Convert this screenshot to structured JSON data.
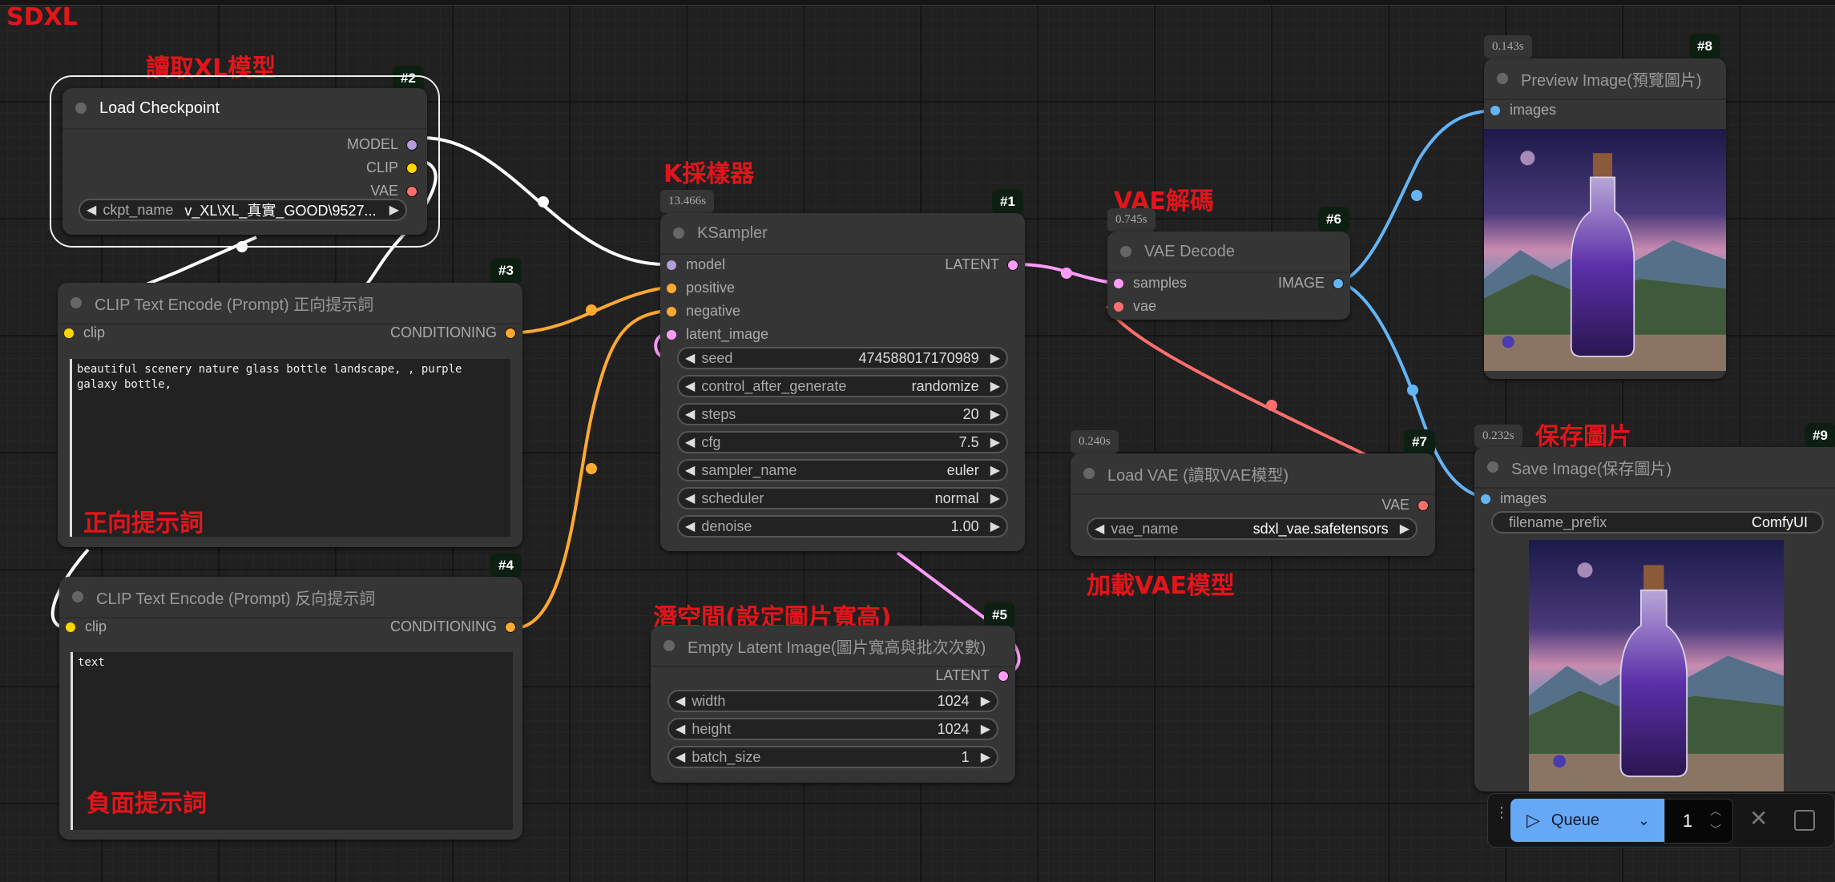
{
  "canvas_title": "SDXL",
  "annotations": {
    "load_model": "讀取XL模型",
    "ksampler": "K採樣器",
    "vae_decode": "VAE解碼",
    "positive_prompt": "正向提示詞",
    "negative_prompt": "負面提示詞",
    "latent_space": "潛空間(設定圖片寬高)",
    "load_vae": "加載VAE模型",
    "save_image": "保存圖片"
  },
  "nodes": {
    "load_checkpoint": {
      "id": "#2",
      "title": "Load Checkpoint",
      "outputs": [
        "MODEL",
        "CLIP",
        "VAE"
      ],
      "widgets": [
        {
          "label": "ckpt_name",
          "value": "v_XL\\XL_真實_GOOD\\9527..."
        }
      ]
    },
    "clip_positive": {
      "id": "#3",
      "title": "CLIP Text Encode (Prompt) 正向提示詞",
      "input": "clip",
      "output": "CONDITIONING",
      "text": "beautiful scenery nature glass bottle landscape, , purple galaxy bottle,"
    },
    "clip_negative": {
      "id": "#4",
      "title": "CLIP Text Encode (Prompt) 反向提示詞",
      "input": "clip",
      "output": "CONDITIONING",
      "text": "text"
    },
    "ksampler": {
      "id": "#1",
      "time": "13.466s",
      "title": "KSampler",
      "inputs": [
        "model",
        "positive",
        "negative",
        "latent_image"
      ],
      "output": "LATENT",
      "widgets": [
        {
          "label": "seed",
          "value": "474588017170989"
        },
        {
          "label": "control_after_generate",
          "value": "randomize"
        },
        {
          "label": "steps",
          "value": "20"
        },
        {
          "label": "cfg",
          "value": "7.5"
        },
        {
          "label": "sampler_name",
          "value": "euler"
        },
        {
          "label": "scheduler",
          "value": "normal"
        },
        {
          "label": "denoise",
          "value": "1.00"
        }
      ]
    },
    "empty_latent": {
      "id": "#5",
      "title": "Empty Latent Image(圖片寬高與批次次數)",
      "output": "LATENT",
      "widgets": [
        {
          "label": "width",
          "value": "1024"
        },
        {
          "label": "height",
          "value": "1024"
        },
        {
          "label": "batch_size",
          "value": "1"
        }
      ]
    },
    "vae_decode": {
      "id": "#6",
      "time": "0.745s",
      "title": "VAE Decode",
      "inputs": [
        "samples",
        "vae"
      ],
      "output": "IMAGE"
    },
    "load_vae": {
      "id": "#7",
      "time": "0.240s",
      "title": "Load VAE (讀取VAE模型)",
      "output": "VAE",
      "widgets": [
        {
          "label": "vae_name",
          "value": "sdxl_vae.safetensors"
        }
      ]
    },
    "preview_image": {
      "id": "#8",
      "time": "0.143s",
      "title": "Preview Image(預覽圖片)",
      "input": "images"
    },
    "save_image": {
      "id": "#9",
      "time": "0.232s",
      "title": "Save Image(保存圖片)",
      "input": "images",
      "widgets": [
        {
          "label": "filename_prefix",
          "value": "ComfyUI"
        }
      ]
    }
  },
  "slot_colors": {
    "MODEL": "#b39ddb",
    "CLIP": "#ffd500",
    "VAE": "#ff6e6e",
    "CONDITIONING": "#ffa931",
    "LATENT": "#ff9cf9",
    "IMAGE": "#64b5f6"
  },
  "queue_bar": {
    "queue_label": "Queue",
    "batch_count": "1",
    "accent": "#64a8f6"
  }
}
